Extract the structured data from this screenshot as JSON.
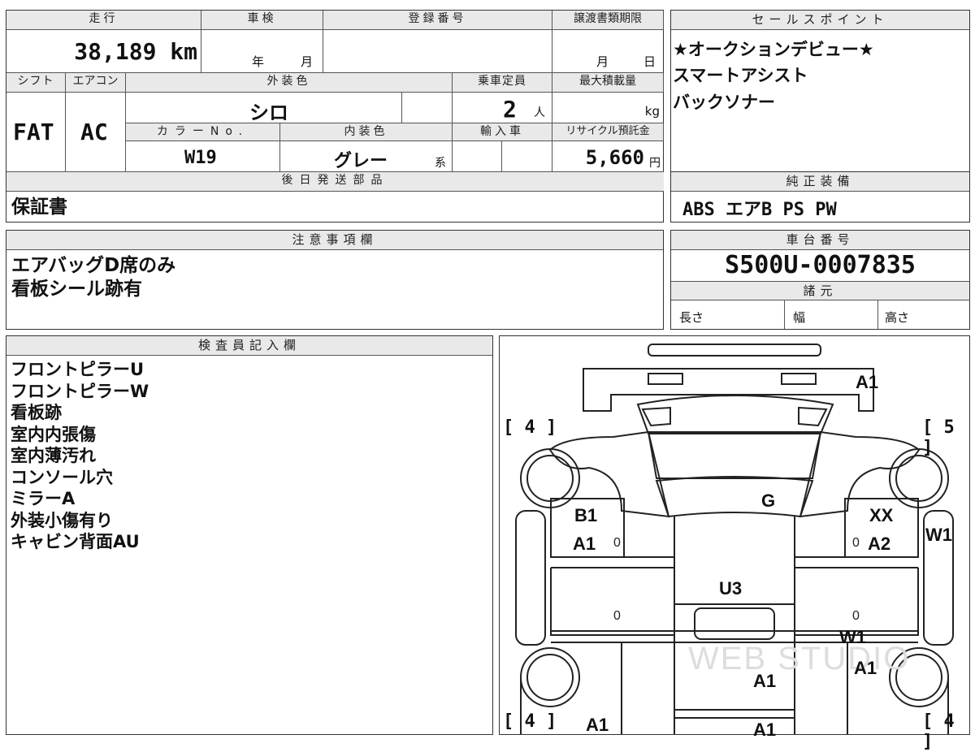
{
  "labels": {
    "mileage": "走行",
    "inspection": "車検",
    "registration": "登録番号",
    "transfer_deadline": "譲渡書類期限",
    "sales_points": "セールスポイント",
    "shift": "シフト",
    "aircon": "エアコン",
    "exterior_color": "外装色",
    "capacity": "乗車定員",
    "max_load": "最大積載量",
    "color_no": "カラーNo.",
    "interior_color": "内装色",
    "import": "輸入車",
    "recycle": "リサイクル預託金",
    "later_parts": "後日発送部品",
    "factory_equipment": "純正装備",
    "notes": "注意事項欄",
    "chassis": "車台番号",
    "specs": "諸元",
    "length": "長さ",
    "width": "幅",
    "height": "高さ",
    "inspector": "検査員記入欄"
  },
  "values": {
    "mileage": "38,189 km",
    "inspection_year_unit": "年",
    "inspection_month_unit": "月",
    "transfer_month_unit": "月",
    "transfer_day_unit": "日",
    "shift": "FAT",
    "aircon": "AC",
    "exterior_color": "シロ",
    "capacity": "2",
    "capacity_unit": "人",
    "max_load_unit": "kg",
    "color_no": "W19",
    "interior_color": "グレー",
    "interior_suffix": "系",
    "recycle": "5,660",
    "recycle_unit": "円",
    "later_parts": "保証書",
    "factory_equipment": "ABS エアB PS PW",
    "chassis_number": "S500U-0007835"
  },
  "sales_points": [
    "★オークションデビュー★",
    "スマートアシスト",
    "バックソナー"
  ],
  "notes": [
    "エアバッグD席のみ",
    "看板シール跡有"
  ],
  "inspector_items": [
    "フロントピラーU",
    "フロントピラーW",
    "看板跡",
    "室内内張傷",
    "室内薄汚れ",
    "コンソール穴",
    "ミラーA",
    "外装小傷有り",
    "キャビン背面AU"
  ],
  "diagram": {
    "tire_front_left": "[ 4 ]",
    "tire_front_right": "[ 5 ]",
    "tire_rear_left": "[ 4 ]",
    "tire_rear_right": "[ 4 ]",
    "marks": {
      "bumper": "A1",
      "windshield": "G",
      "left_door_1": "B1",
      "left_door_2": "A1",
      "right_door_1": "XX",
      "right_door_2": "A2",
      "right_pillar": "W1",
      "roof": "U3",
      "right_bed": "W1",
      "right_rear": "A1",
      "bed": "A1",
      "left_rear": "A1",
      "rear_center": "A1"
    },
    "zero": "0",
    "watermark": "WEB STUDIO"
  }
}
